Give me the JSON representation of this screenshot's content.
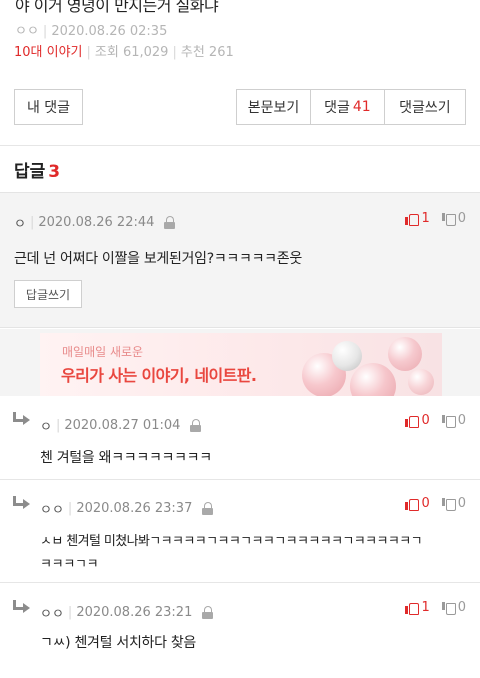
{
  "post": {
    "title": "야 이거 영녕이 만지는거 실화냐",
    "author": "ㅇㅇ",
    "date": "2020.08.26 02:35",
    "category": "10대 이야기",
    "views_label": "조회",
    "views": "61,029",
    "likes_label": "추천",
    "likes": "261"
  },
  "buttons": {
    "my_comments": "내 댓글",
    "view_post": "본문보기",
    "comments_label": "댓글",
    "comments_count": "41",
    "write_comment": "댓글쓰기"
  },
  "replies": {
    "label": "답글",
    "count": "3"
  },
  "best_comment": {
    "author": "ㅇ",
    "date": "2020.08.26 22:44",
    "text": "근데 넌 어쩌다 이짤을 보게된거임?ㅋㅋㅋㅋㅋ존웃",
    "up": "1",
    "down": "0",
    "reply_button": "답글쓰기"
  },
  "ad": {
    "subtitle": "매일매일 새로운",
    "headline": "우리가 사는 이야기, 네이트판."
  },
  "comments": [
    {
      "author": "ㅇ",
      "date": "2020.08.27 01:04",
      "text": "첸 겨털을 왜ㅋㅋㅋㅋㅋㅋㅋㅋ",
      "up": "0",
      "down": "0"
    },
    {
      "author": "ㅇㅇ",
      "date": "2020.08.26 23:37",
      "text": "ㅅㅂ 첸겨털 미쳤나봐ㄱㅋㅋㅋㅋㄱㅋㅋㄱㅋㅋㄱㅋㅋㅋㅋㅋㄱㅋㅋㅋㅋㅋㄱ",
      "text2": "ㅋㅋㅋㄱㅋ",
      "up": "0",
      "down": "0"
    },
    {
      "author": "ㅇㅇ",
      "date": "2020.08.26 23:21",
      "text": "ㄱㅆ) 첸겨털 서치하다 찾음",
      "up": "1",
      "down": "0"
    }
  ],
  "colors": {
    "accent": "#e02a2a",
    "ad_text": "#e9473f",
    "muted": "#b5b5b5"
  }
}
